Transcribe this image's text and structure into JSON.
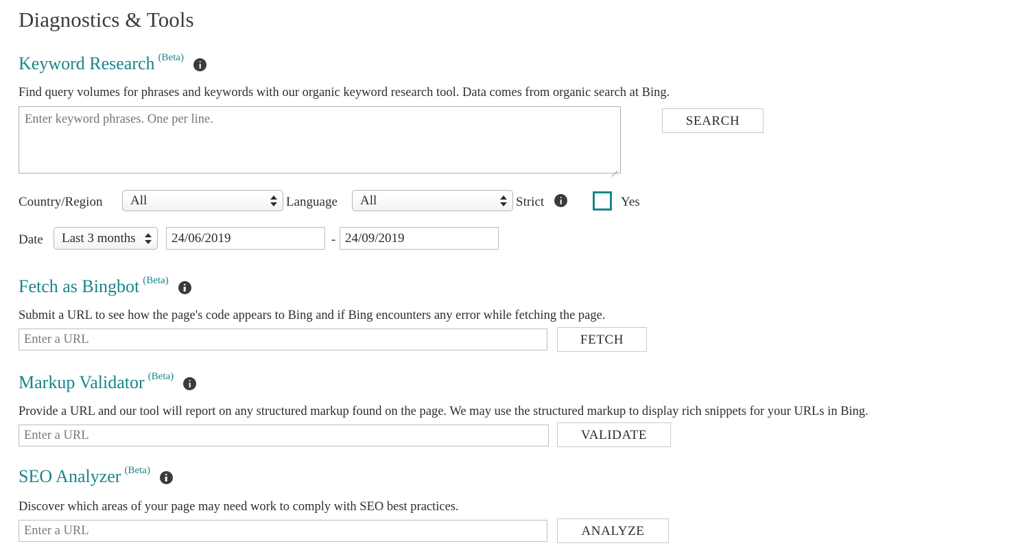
{
  "page": {
    "title": "Diagnostics & Tools"
  },
  "colors": {
    "heading_teal": "#17858c",
    "body_text": "#2f2f2f",
    "title_text": "#3a3a3a",
    "info_icon": "#3b3b3b",
    "checkbox_border": "#17858c",
    "input_border": "#bdbdbd",
    "button_border": "#c9c9c9",
    "placeholder": "#7a7a7a"
  },
  "sections": {
    "keyword_research": {
      "title": "Keyword Research",
      "beta": "(Beta)",
      "info_icon": "info-circle-icon",
      "description": "Find query volumes for phrases and keywords with our organic keyword research tool. Data comes from organic search at Bing.",
      "textarea": {
        "placeholder": "Enter keyword phrases. One per line.",
        "value": ""
      },
      "search_button": "SEARCH",
      "filters": {
        "country_label": "Country/Region",
        "country_value": "All",
        "language_label": "Language",
        "language_value": "All",
        "strict_label": "Strict",
        "strict_info_icon": "info-circle-icon",
        "strict_checkbox_checked": false,
        "strict_yes_label": "Yes",
        "date_label": "Date",
        "date_range_value": "Last 3 months",
        "date_from": "24/06/2019",
        "date_separator": "-",
        "date_to": "24/09/2019"
      }
    },
    "fetch_as_bingbot": {
      "title": "Fetch as Bingbot",
      "beta": "(Beta)",
      "info_icon": "info-circle-icon",
      "description": "Submit a URL to see how the page's code appears to Bing and if Bing encounters any error while fetching the page.",
      "input_placeholder": "Enter a URL",
      "input_value": "",
      "button": "FETCH"
    },
    "markup_validator": {
      "title": "Markup Validator",
      "beta": "(Beta)",
      "info_icon": "info-circle-icon",
      "description": "Provide a URL and our tool will report on any structured markup found on the page. We may use the structured markup to display rich snippets for your URLs in Bing.",
      "input_placeholder": "Enter a URL",
      "input_value": "",
      "button": "VALIDATE"
    },
    "seo_analyzer": {
      "title": "SEO Analyzer",
      "beta": "(Beta)",
      "info_icon": "info-circle-icon",
      "description": "Discover which areas of your page may need work to comply with SEO best practices.",
      "input_placeholder": "Enter a URL",
      "input_value": "",
      "button": "ANALYZE"
    }
  }
}
